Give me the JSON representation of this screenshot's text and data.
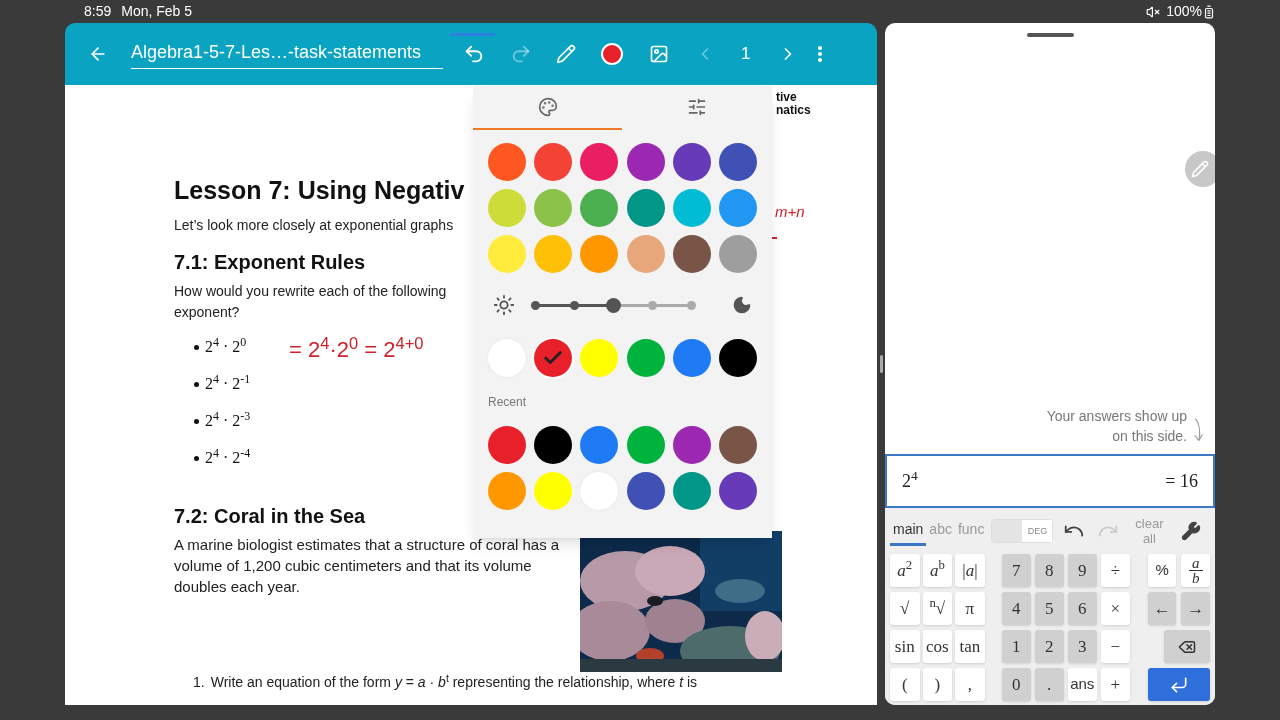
{
  "status_bar": {
    "time": "8:59",
    "date": "Mon, Feb 5",
    "battery": "100%"
  },
  "toolbar": {
    "title": "Algebra1-5-7-Les…-task-statements",
    "undo_disabled": false,
    "redo_disabled": true,
    "prev_disabled": true,
    "page": "1",
    "next_disabled": false
  },
  "document": {
    "logo_lines": [
      "tive",
      "natics"
    ],
    "title": "Lesson 7: Using Negativ",
    "intro": "Let’s look more closely at exponential graphs",
    "section_1": {
      "heading": "7.1: Exponent Rules",
      "question_lines": [
        "How would you rewrite each of the following",
        "exponent?"
      ],
      "items": [
        "2$^{4}$ · 2$^{0}$",
        "2$^{4}$ · 2$^{-1}$",
        "2$^{4}$ · 2$^{-3}$",
        "2$^{4}$ · 2$^{-4}$"
      ]
    },
    "ink": {
      "work": "= 2$^{4}$·2$^{0}$ = 2$^{4+0}$",
      "margin_note": "m+n"
    },
    "section_2": {
      "heading": "7.2: Coral in the Sea",
      "paragraph": "A marine biologist estimates that a structure of coral has a volume of 1,200 cubic centimeters and that its volume doubles each year.",
      "task_number": "1.",
      "task": "Write an equation of the form *y* = *a* · *b*$^{t}$ representing the relationship, where *t* is"
    }
  },
  "palette": {
    "tabs": [
      {
        "kind": "colors",
        "selected": true
      },
      {
        "kind": "settings",
        "selected": false
      }
    ],
    "swatch_rows": [
      [
        {
          "color": "#ff5722",
          "selected": false
        },
        {
          "color": "#f44336",
          "selected": false
        },
        {
          "color": "#e91e63",
          "selected": false
        },
        {
          "color": "#9c27b0",
          "selected": false
        },
        {
          "color": "#673ab7",
          "selected": false
        },
        {
          "color": "#3f51b5",
          "selected": false
        }
      ],
      [
        {
          "color": "#cddc39",
          "selected": false
        },
        {
          "color": "#8bc34a",
          "selected": false
        },
        {
          "color": "#4caf50",
          "selected": false
        },
        {
          "color": "#009688",
          "selected": false
        },
        {
          "color": "#00bcd4",
          "selected": false
        },
        {
          "color": "#2196f3",
          "selected": false
        }
      ],
      [
        {
          "color": "#ffeb3b",
          "selected": false
        },
        {
          "color": "#ffc107",
          "selected": false
        },
        {
          "color": "#ff9800",
          "selected": false
        },
        {
          "color": "#e8a77a",
          "selected": false
        },
        {
          "color": "#795548",
          "selected": false
        },
        {
          "color": "#9e9e9e",
          "selected": false
        }
      ]
    ],
    "brightness": {
      "level": 0.5
    },
    "shades": [
      {
        "color": "#ffffff",
        "selected": false
      },
      {
        "color": "#e8202a",
        "selected": true
      },
      {
        "color": "#ffff00",
        "selected": false
      },
      {
        "color": "#00b33c",
        "selected": false
      },
      {
        "color": "#1e7bf5",
        "selected": false
      },
      {
        "color": "#000000",
        "selected": false
      }
    ],
    "recent_label": "Recent",
    "recent_rows": [
      [
        {
          "color": "#e8202a",
          "selected": false
        },
        {
          "color": "#000000",
          "selected": false
        },
        {
          "color": "#1e7bf5",
          "selected": false
        },
        {
          "color": "#00b33c",
          "selected": false
        },
        {
          "color": "#9c27b0",
          "selected": false
        },
        {
          "color": "#795548",
          "selected": false
        }
      ],
      [
        {
          "color": "#ff9800",
          "selected": false
        },
        {
          "color": "#ffff00",
          "selected": false
        },
        {
          "color": "#ffffff",
          "selected": false
        },
        {
          "color": "#3f51b5",
          "selected": false
        },
        {
          "color": "#009688",
          "selected": false
        },
        {
          "color": "#673ab7",
          "selected": false
        }
      ]
    ]
  },
  "calculator": {
    "hint": "Your answers show up on this side.",
    "expression": "2$^{4}$",
    "result": "= 16",
    "tabs": [
      {
        "label": "main",
        "selected": true
      },
      {
        "label": "abc",
        "selected": false
      },
      {
        "label": "func",
        "selected": false
      }
    ],
    "angle_toggle": "DEG",
    "undo_disabled": false,
    "redo_disabled": true,
    "clear_label": "clear all",
    "key_groups": [
      [
        {
          "kind": "light",
          "label": "*a*$^{2}$"
        },
        {
          "kind": "light",
          "label": "*a*$^{b}$"
        },
        {
          "kind": "light",
          "label": "|*a*|"
        },
        {
          "kind": "light",
          "label": "√"
        },
        {
          "kind": "light",
          "label": "$^{n}$√"
        },
        {
          "kind": "light",
          "label": "π"
        },
        {
          "kind": "light",
          "label": "sin"
        },
        {
          "kind": "light",
          "label": "cos"
        },
        {
          "kind": "light",
          "label": "tan"
        },
        {
          "kind": "light",
          "label": "("
        },
        {
          "kind": "light",
          "label": ")"
        },
        {
          "kind": "light",
          "label": ","
        }
      ],
      [
        {
          "kind": "dark",
          "label": "7"
        },
        {
          "kind": "dark",
          "label": "8"
        },
        {
          "kind": "dark",
          "label": "9"
        },
        {
          "kind": "light",
          "label": "÷"
        },
        {
          "kind": "dark",
          "label": "4"
        },
        {
          "kind": "dark",
          "label": "5"
        },
        {
          "kind": "dark",
          "label": "6"
        },
        {
          "kind": "light",
          "label": "×"
        },
        {
          "kind": "dark",
          "label": "1"
        },
        {
          "kind": "dark",
          "label": "2"
        },
        {
          "kind": "dark",
          "label": "3"
        },
        {
          "kind": "light",
          "label": "−"
        },
        {
          "kind": "dark",
          "label": "0"
        },
        {
          "kind": "dark",
          "label": "."
        },
        {
          "kind": "word",
          "label": "ans"
        },
        {
          "kind": "light",
          "label": "+"
        }
      ],
      [
        {
          "kind": "word",
          "label": "%"
        },
        {
          "kind": "fraction",
          "numerator": "a",
          "denominator": "b"
        },
        {
          "kind": "dark",
          "label": "←"
        },
        {
          "kind": "dark",
          "label": "→"
        },
        {
          "kind": "backspace"
        },
        {
          "kind": "enter"
        }
      ]
    ]
  }
}
